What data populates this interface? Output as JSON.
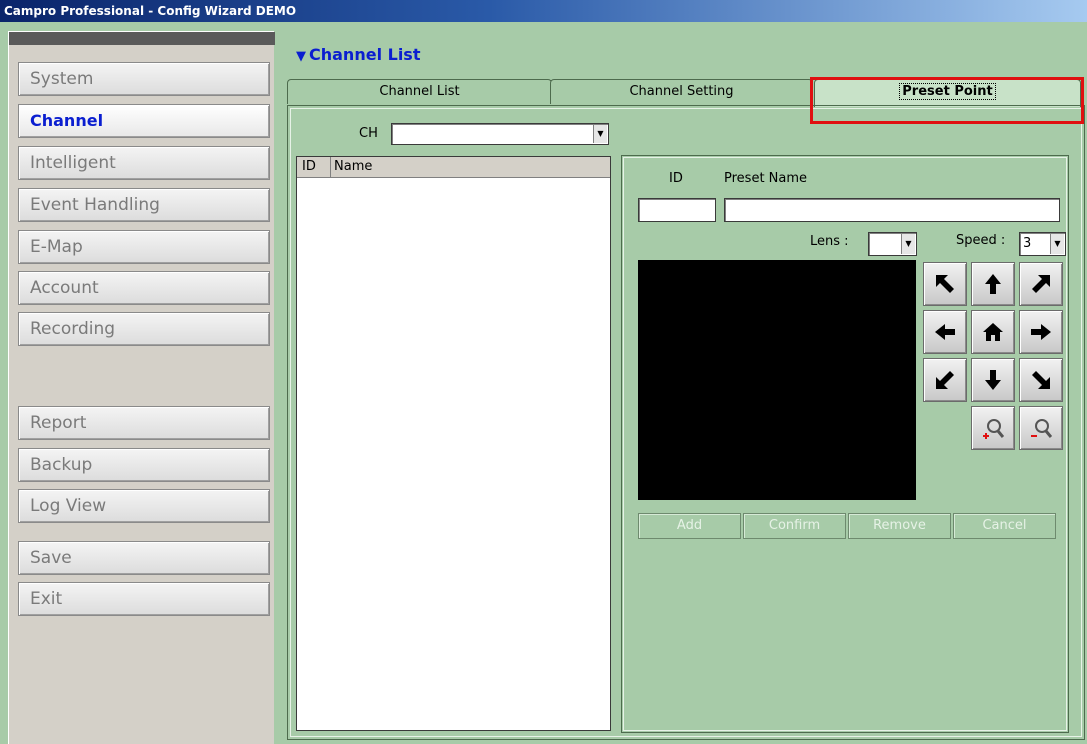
{
  "window": {
    "title": "Campro Professional - Config Wizard DEMO"
  },
  "sidebar": {
    "items": [
      {
        "label": "System"
      },
      {
        "label": "Channel"
      },
      {
        "label": "Intelligent"
      },
      {
        "label": "Event Handling"
      },
      {
        "label": "E-Map"
      },
      {
        "label": "Account"
      },
      {
        "label": "Recording"
      },
      {
        "label": "Report"
      },
      {
        "label": "Backup"
      },
      {
        "label": "Log View"
      },
      {
        "label": "Save"
      },
      {
        "label": "Exit"
      }
    ],
    "active": "Channel"
  },
  "main": {
    "section_title": "Channel List",
    "tabs": [
      {
        "label": "Channel List"
      },
      {
        "label": "Channel Setting"
      },
      {
        "label": "Preset Point",
        "selected": true
      }
    ]
  },
  "channel": {
    "ch_label": "CH",
    "ch_value": "",
    "list_columns": [
      "ID",
      "Name"
    ]
  },
  "preset": {
    "id_label": "ID",
    "name_label": "Preset Name",
    "id_value": "",
    "name_value": "",
    "lens_label": "Lens :",
    "lens_value": "",
    "speed_label": "Speed :",
    "speed_value": "3",
    "ptz_buttons": [
      "up-left-arrow-icon",
      "up-arrow-icon",
      "up-right-arrow-icon",
      "left-arrow-icon",
      "home-icon",
      "right-arrow-icon",
      "down-left-arrow-icon",
      "down-arrow-icon",
      "down-right-arrow-icon",
      "zoom-in-icon",
      "zoom-out-icon"
    ],
    "actions": [
      {
        "label": "Add"
      },
      {
        "label": "Confirm"
      },
      {
        "label": "Remove"
      },
      {
        "label": "Cancel"
      }
    ]
  },
  "colors": {
    "highlight": "#e01010",
    "active_nav": "#0a1ed0",
    "panel_bg": "#a7cba8"
  }
}
